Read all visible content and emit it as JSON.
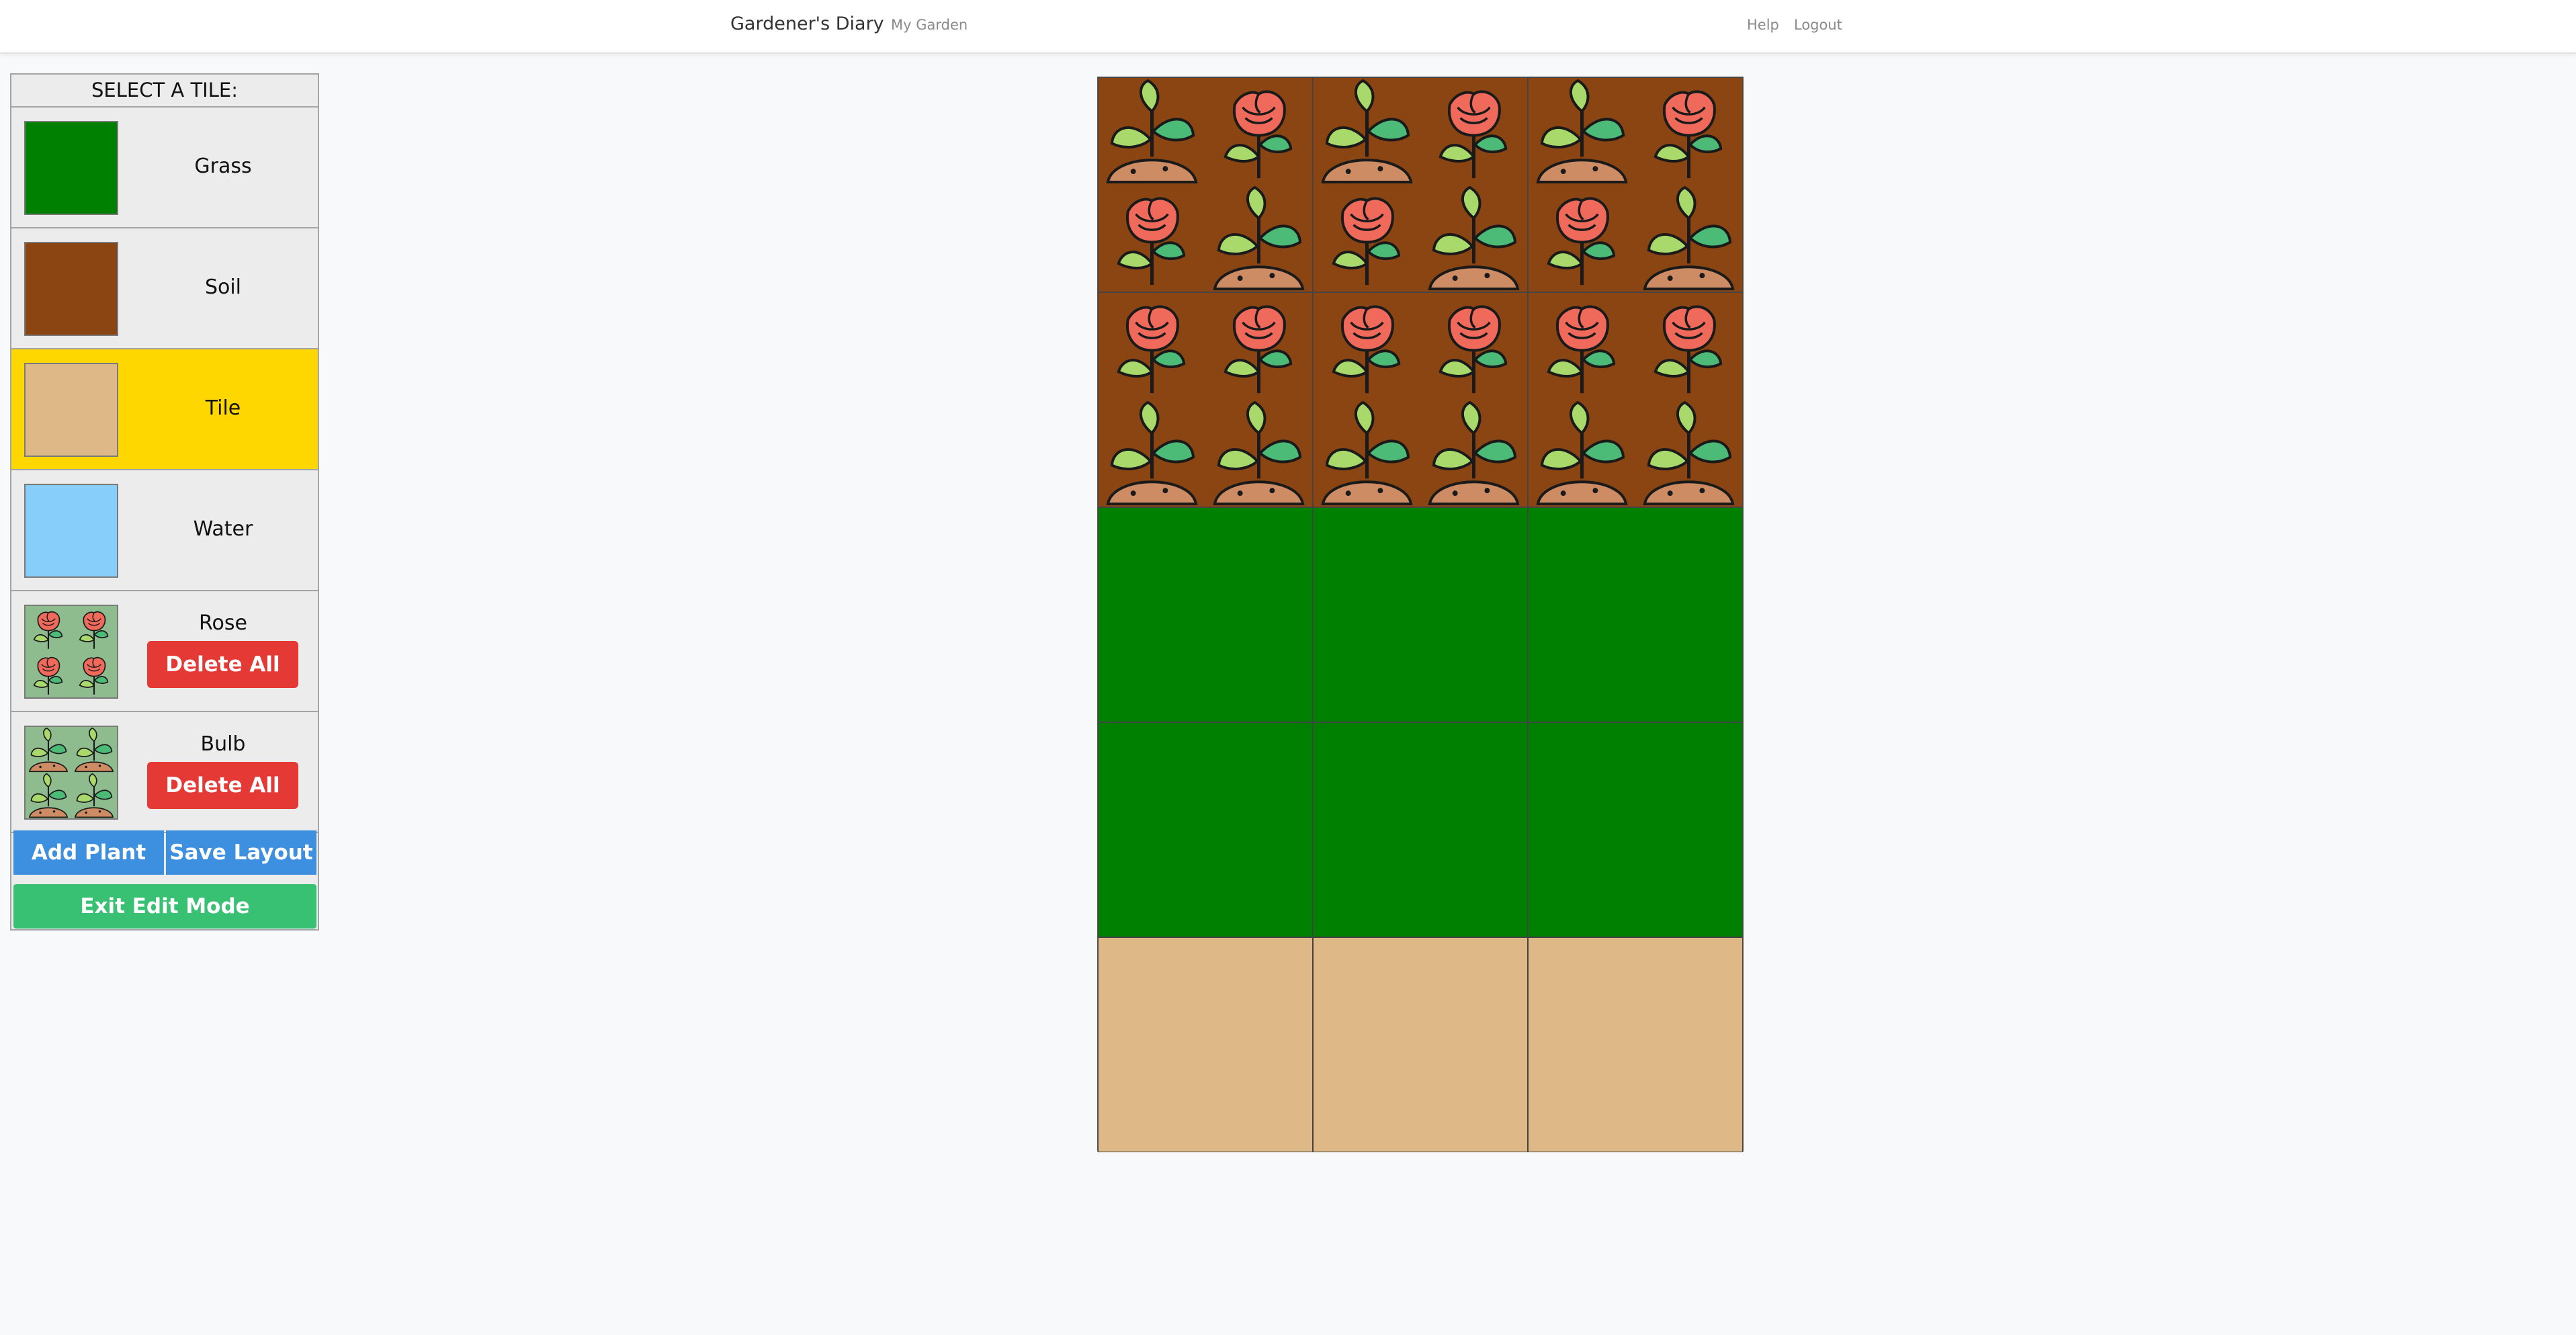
{
  "navbar": {
    "brand": "Gardener's Diary",
    "links": {
      "garden": "My Garden",
      "help": "Help",
      "logout": "Logout"
    }
  },
  "sidebar": {
    "header": "SELECT A TILE:",
    "selected_tile": "Tile",
    "tiles": [
      {
        "label": "Grass",
        "color": "#008000"
      },
      {
        "label": "Soil",
        "color": "#8b4513"
      },
      {
        "label": "Tile",
        "color": "#deb887"
      },
      {
        "label": "Water",
        "color": "#87cefa"
      }
    ],
    "plants": [
      {
        "label": "Rose",
        "icon": "rose-icon",
        "swatch_bg": "#8fbc8f",
        "delete_label": "Delete All"
      },
      {
        "label": "Bulb",
        "icon": "bulb-icon",
        "swatch_bg": "#8fbc8f",
        "delete_label": "Delete All"
      }
    ],
    "buttons": {
      "add": "Add Plant",
      "save": "Save Layout",
      "exit": "Exit Edit Mode"
    }
  },
  "colors": {
    "selected_highlight": "#ffd700",
    "delete": "#e53935",
    "primary": "#3d8fdf",
    "success": "#38c172",
    "rose_petal": "#f06a5b",
    "leaf_light": "#a9d96a",
    "leaf_dark": "#4cbb78",
    "mound": "#cd8c63"
  },
  "garden": {
    "rows": [
      [
        {
          "tile": "soil",
          "plants": [
            "bulb",
            "rose",
            "rose",
            "bulb"
          ]
        },
        {
          "tile": "soil",
          "plants": [
            "bulb",
            "rose",
            "rose",
            "bulb"
          ]
        },
        {
          "tile": "soil",
          "plants": [
            "bulb",
            "rose",
            "rose",
            "bulb"
          ]
        }
      ],
      [
        {
          "tile": "soil",
          "plants": [
            "rose",
            "rose",
            "bulb",
            "bulb"
          ]
        },
        {
          "tile": "soil",
          "plants": [
            "rose",
            "rose",
            "bulb",
            "bulb"
          ]
        },
        {
          "tile": "soil",
          "plants": [
            "rose",
            "rose",
            "bulb",
            "bulb"
          ]
        }
      ],
      [
        {
          "tile": "grass",
          "plants": []
        },
        {
          "tile": "grass",
          "plants": []
        },
        {
          "tile": "grass",
          "plants": []
        }
      ],
      [
        {
          "tile": "grass",
          "plants": []
        },
        {
          "tile": "grass",
          "plants": []
        },
        {
          "tile": "grass",
          "plants": []
        }
      ],
      [
        {
          "tile": "tile",
          "plants": []
        },
        {
          "tile": "tile",
          "plants": []
        },
        {
          "tile": "tile",
          "plants": []
        }
      ]
    ]
  }
}
